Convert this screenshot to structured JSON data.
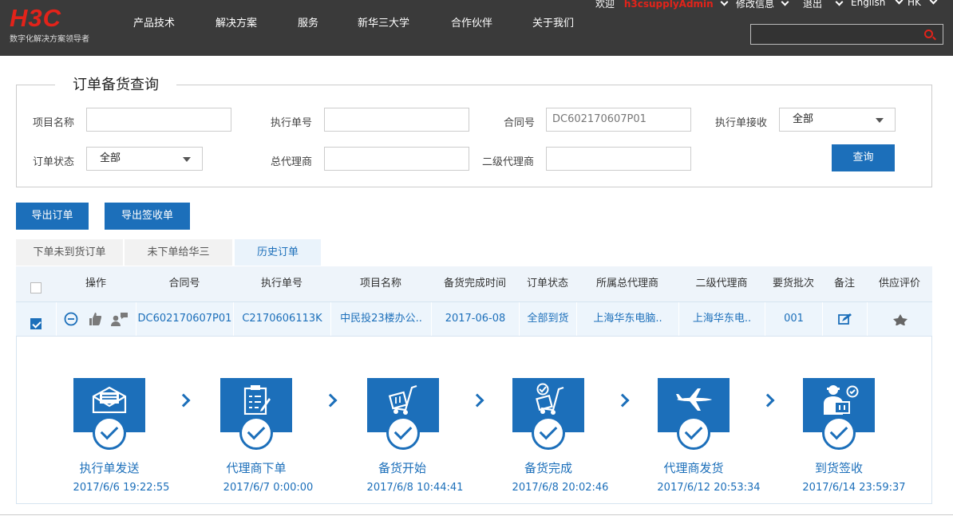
{
  "header": {
    "logo_text": "H3C",
    "logo_tagline": "数字化解决方案领导者",
    "nav": [
      "产品技术",
      "解决方案",
      "服务",
      "新华三大学",
      "合作伙伴",
      "关于我们"
    ],
    "welcome": "欢迎",
    "username": "h3csupplyAdmin",
    "profile_label": "修改信息",
    "logout_label": "退出",
    "language": "English",
    "region": "HK",
    "search_value": ""
  },
  "query": {
    "legend": "订单备货查询",
    "project_name_label": "项目名称",
    "project_name_value": "",
    "exec_no_label": "执行单号",
    "exec_no_value": "",
    "contract_label": "合同号",
    "contract_value": "DC602170607P01",
    "exec_receive_label": "执行单接收",
    "exec_receive_value": "全部",
    "order_status_label": "订单状态",
    "order_status_value": "全部",
    "general_agent_label": "总代理商",
    "general_agent_value": "",
    "secondary_agent_label": "二级代理商",
    "secondary_agent_value": "",
    "search_button": "查询"
  },
  "actions": {
    "export_orders": "导出订单",
    "export_receipts": "导出签收单"
  },
  "tabs": [
    {
      "label": "下单未到货订单",
      "active": false
    },
    {
      "label": "未下单给华三",
      "active": false
    },
    {
      "label": "历史订单",
      "active": true
    }
  ],
  "table": {
    "columns": [
      "操作",
      "合同号",
      "执行单号",
      "项目名称",
      "备货完成时间",
      "订单状态",
      "所属总代理商",
      "二级代理商",
      "要货批次",
      "备注",
      "供应评价"
    ],
    "rows": [
      {
        "checked": true,
        "contract": "DC602170607P01",
        "exec_no": "C2170606113K",
        "project": "中民投23楼办公..",
        "stock_complete": "2017-06-08",
        "status": "全部到货",
        "general_agent": "上海华东电脑..",
        "secondary_agent": "上海华东电..",
        "batch": "001",
        "note_icon": "edit-note-icon",
        "rating_icon": "star-icon"
      }
    ]
  },
  "progress": [
    {
      "title": "执行单发送",
      "time": "2017/6/6 19:22:55",
      "icon": "envelope-icon"
    },
    {
      "title": "代理商下单",
      "time": "2017/6/7 0:00:00",
      "icon": "clipboard-icon"
    },
    {
      "title": "备货开始",
      "time": "2017/6/8 10:44:41",
      "icon": "handcart-icon"
    },
    {
      "title": "备货完成",
      "time": "2017/6/8 20:02:46",
      "icon": "handcart-check-icon"
    },
    {
      "title": "代理商发货",
      "time": "2017/6/12 20:53:34",
      "icon": "airplane-icon"
    },
    {
      "title": "到货签收",
      "time": "2017/6/14 23:59:37",
      "icon": "courier-icon"
    }
  ],
  "colors": {
    "brand_red": "#e2231a",
    "primary_blue": "#1c6fba",
    "header_bg": "#3a3a3a"
  }
}
